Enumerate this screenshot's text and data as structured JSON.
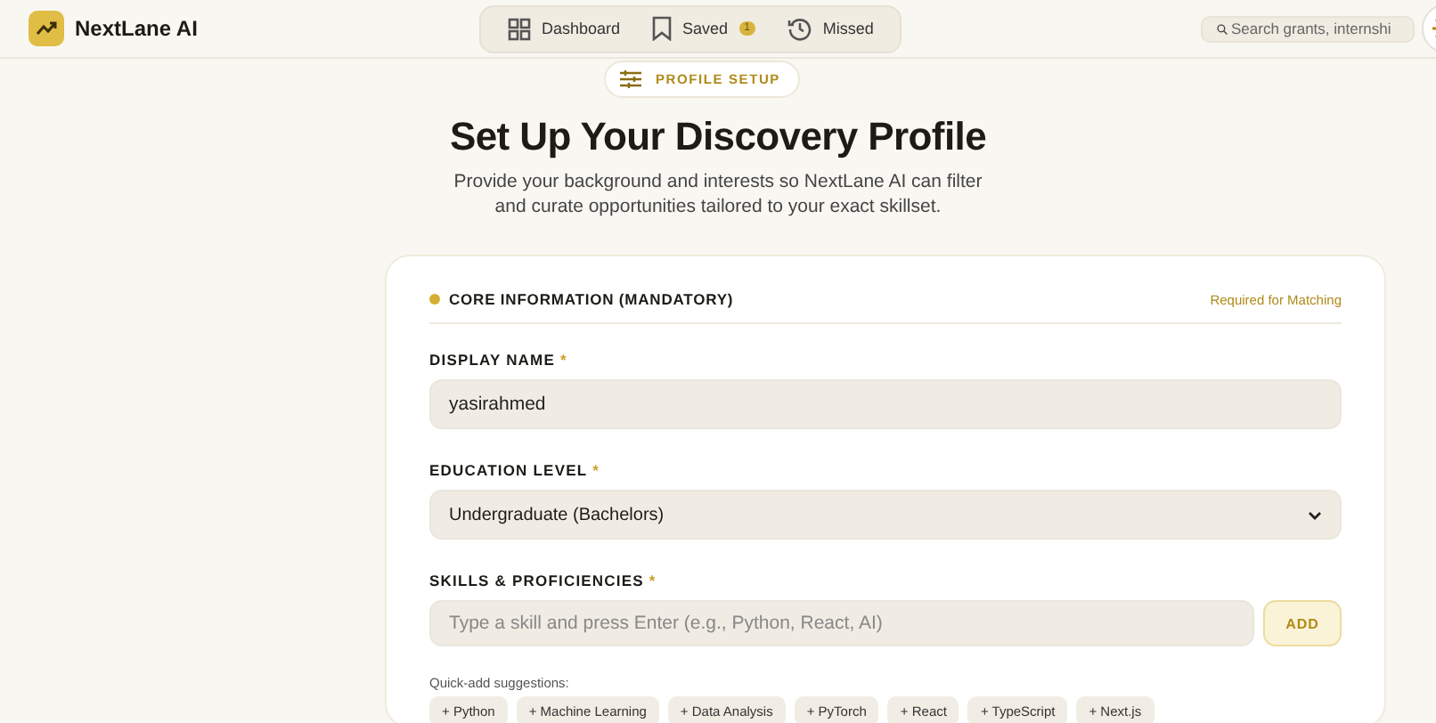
{
  "header": {
    "brand": "NextLane AI",
    "nav": [
      {
        "label": "Dashboard",
        "selected": false
      },
      {
        "label": "Saved",
        "selected": false,
        "badge": "1"
      },
      {
        "label": "Missed",
        "selected": false
      }
    ],
    "search": {
      "placeholder": "Search grants, internshi"
    }
  },
  "hero": {
    "pill": "PROFILE SETUP",
    "title": "Set Up Your Discovery Profile",
    "subtitle": "Provide your background and interests so NextLane AI can filter and curate opportunities tailored to your exact skillset."
  },
  "form": {
    "section": {
      "title": "CORE INFORMATION (MANDATORY)",
      "note": "Required for Matching"
    },
    "fields": [
      {
        "kind": "text",
        "label": "DISPLAY NAME",
        "required_mark": "*",
        "value": "yasirahmed"
      },
      {
        "kind": "select",
        "label": "EDUCATION LEVEL",
        "required_mark": "*",
        "value": "Undergraduate (Bachelors)"
      },
      {
        "kind": "add",
        "label": "SKILLS & PROFICIENCIES",
        "required_mark": "*",
        "placeholder": "Type a skill and press Enter (e.g., Python, React, AI)",
        "button": "ADD"
      }
    ],
    "suggestions": {
      "label": "Quick-add suggestions:",
      "items": [
        "+ Python",
        "+ Machine Learning",
        "+ Data Analysis",
        "+ PyTorch",
        "+ React",
        "+ TypeScript",
        "+ Next.js"
      ]
    }
  }
}
